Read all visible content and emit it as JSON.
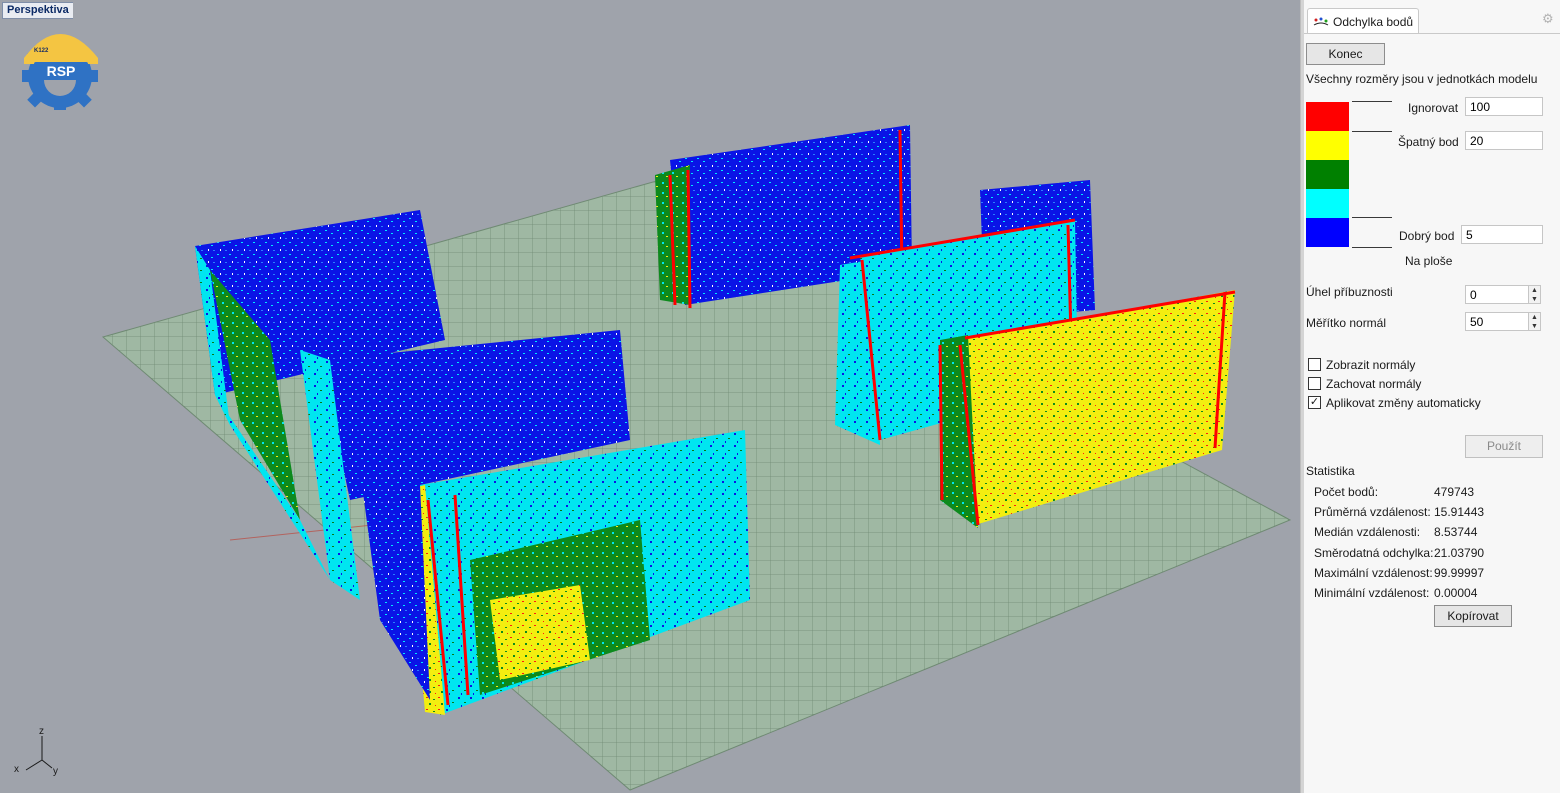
{
  "viewport": {
    "label": "Perspektiva",
    "logo_text": "RSP",
    "logo_badge": "K122",
    "axis": {
      "z": "z",
      "x": "x",
      "y": "y"
    }
  },
  "panel": {
    "title": "Odchylka bodů",
    "end_button": "Konec",
    "units_note": "Všechny rozměry jsou v jednotkách modelu",
    "legend": {
      "colors": [
        "#ff0000",
        "#ffff00",
        "#008000",
        "#00ffff",
        "#0000ff"
      ],
      "ignore_label": "Ignorovat",
      "ignore_value": "100",
      "bad_label": "Špatný bod",
      "bad_value": "20",
      "good_label": "Dobrý bod",
      "good_value": "5",
      "on_surface": "Na ploše"
    },
    "angle_label": "Úhel příbuznosti",
    "angle_value": "0",
    "normal_scale_label": "Měřítko normál",
    "normal_scale_value": "50",
    "checkboxes": [
      {
        "label": "Zobrazit normály",
        "checked": false
      },
      {
        "label": "Zachovat normály",
        "checked": false
      },
      {
        "label": "Aplikovat změny automaticky",
        "checked": true
      }
    ],
    "apply_button": "Použít",
    "stats": {
      "title": "Statistika",
      "rows": [
        {
          "label": "Počet bodů:",
          "value": "479743"
        },
        {
          "label": "Průměrná vzdálenost:",
          "value": "15.91443"
        },
        {
          "label": "Medián vzdálenosti:",
          "value": "8.53744"
        },
        {
          "label": "Směrodatná odchylka:",
          "value": "21.03790"
        },
        {
          "label": "Maximální vzdálenost:",
          "value": "99.99997"
        },
        {
          "label": "Minimální vzdálenost:",
          "value": "0.00004"
        }
      ],
      "copy_button": "Kopírovat"
    }
  }
}
